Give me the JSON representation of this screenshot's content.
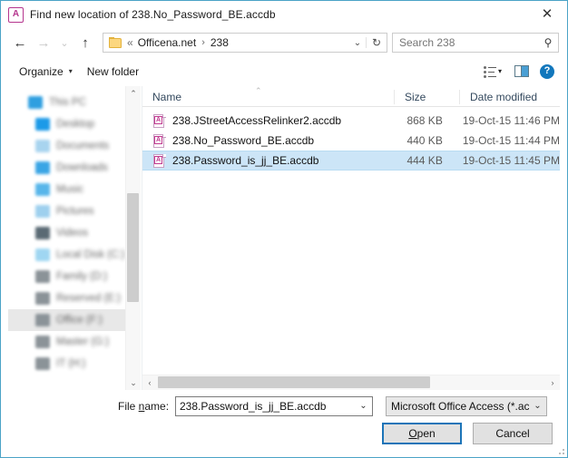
{
  "window": {
    "title": "Find new location of 238.No_Password_BE.accdb",
    "app_icon": "access-icon",
    "icon_letter": "A",
    "close_label": "✕",
    "accent_border": "#4ba3c7",
    "selection_color": "#cce5f7",
    "focus_border": "#1c74b8"
  },
  "nav": {
    "back_label": "←",
    "forward_label": "→",
    "history_label": "⌄",
    "up_label": "↑",
    "address": {
      "folder_icon": "folder-icon",
      "overflow": "«",
      "crumbs": [
        "Officena.net",
        "238"
      ],
      "separator": "›",
      "dropdown_label": "⌄",
      "refresh_label": "↻"
    },
    "search": {
      "value": "",
      "placeholder": "Search 238",
      "icon": "search-icon"
    }
  },
  "toolbar": {
    "organize_label": "Organize",
    "organize_caret": "▾",
    "new_folder_label": "New folder",
    "view_icon": "view-options-icon",
    "view_caret": "▾",
    "preview_pane_icon": "preview-pane-icon",
    "help_icon": "help-icon",
    "help_label": "?"
  },
  "sidebar": {
    "items": [
      {
        "label": "This PC",
        "icon": "this-pc-icon",
        "color": "#2f9fe0",
        "indent": 0,
        "selected": false
      },
      {
        "label": "Desktop",
        "icon": "desktop-icon",
        "color": "#1c9ae8",
        "indent": 1,
        "selected": false
      },
      {
        "label": "Documents",
        "icon": "documents-icon",
        "color": "#a8d4ef",
        "indent": 1,
        "selected": false
      },
      {
        "label": "Downloads",
        "icon": "downloads-icon",
        "color": "#3aa5e5",
        "indent": 1,
        "selected": false
      },
      {
        "label": "Music",
        "icon": "music-icon",
        "color": "#58b6ea",
        "indent": 1,
        "selected": false
      },
      {
        "label": "Pictures",
        "icon": "pictures-icon",
        "color": "#9ed0ee",
        "indent": 1,
        "selected": false
      },
      {
        "label": "Videos",
        "icon": "videos-icon",
        "color": "#5a6a74",
        "indent": 1,
        "selected": false
      },
      {
        "label": "Local Disk (C:)",
        "icon": "local-disk-icon",
        "color": "#9fd6f2",
        "indent": 1,
        "selected": false
      },
      {
        "label": "Family (D:)",
        "icon": "drive-icon",
        "color": "#8b9398",
        "indent": 1,
        "selected": false
      },
      {
        "label": "Reserved (E:)",
        "icon": "drive-icon",
        "color": "#8b9398",
        "indent": 1,
        "selected": false
      },
      {
        "label": "Office (F:)",
        "icon": "drive-icon",
        "color": "#8b9398",
        "indent": 1,
        "selected": true
      },
      {
        "label": "Master (G:)",
        "icon": "drive-icon",
        "color": "#8b9398",
        "indent": 1,
        "selected": false
      },
      {
        "label": "IT (H:)",
        "icon": "drive-icon",
        "color": "#8b9398",
        "indent": 1,
        "selected": false
      }
    ],
    "scroll_up_label": "⌃",
    "scroll_down_label": "⌄"
  },
  "filelist": {
    "sort_indicator": "⌃",
    "columns": [
      {
        "key": "name",
        "label": "Name"
      },
      {
        "key": "size",
        "label": "Size"
      },
      {
        "key": "date",
        "label": "Date modified"
      }
    ],
    "rows": [
      {
        "name": "238.JStreetAccessRelinker2.accdb",
        "size": "868 KB",
        "date": "19-Oct-15 11:46 PM",
        "icon": "access-file-icon",
        "icon_letter": "A",
        "selected": false
      },
      {
        "name": "238.No_Password_BE.accdb",
        "size": "440 KB",
        "date": "19-Oct-15 11:44 PM",
        "icon": "access-file-icon",
        "icon_letter": "A",
        "selected": false
      },
      {
        "name": "238.Password_is_jj_BE.accdb",
        "size": "444 KB",
        "date": "19-Oct-15 11:45 PM",
        "icon": "access-file-icon",
        "icon_letter": "A",
        "selected": true
      }
    ],
    "hscroll_left_label": "‹",
    "hscroll_right_label": "›"
  },
  "footer": {
    "filename_label_pre": "File ",
    "filename_label_accel": "n",
    "filename_label_post": "ame:",
    "filename_value": "238.Password_is_jj_BE.accdb",
    "filename_placeholder": "",
    "filename_dropdown": "⌄",
    "filter_value": "Microsoft Office Access (*.accd",
    "filter_dropdown": "⌄",
    "open_label_pre": "",
    "open_label_accel": "O",
    "open_label_post": "pen",
    "cancel_label": "Cancel"
  }
}
